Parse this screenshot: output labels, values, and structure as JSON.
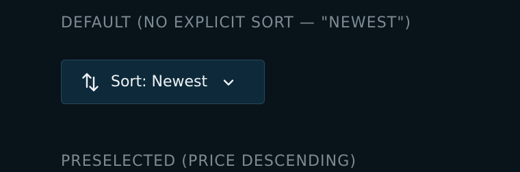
{
  "sections": [
    {
      "heading": "DEFAULT (NO EXPLICIT SORT — \"NEWEST\")",
      "sort_button": {
        "label": "Sort: Newest",
        "icon": "sort-arrows-icon",
        "dropdown_icon": "chevron-down-icon"
      }
    },
    {
      "heading": "PRESELECTED (PRICE DESCENDING)"
    }
  ],
  "colors": {
    "background": "#09131a",
    "heading_text": "#7e8b94",
    "button_background": "#0e2a3a",
    "button_border": "#27475a",
    "button_text": "#eef3f6"
  }
}
